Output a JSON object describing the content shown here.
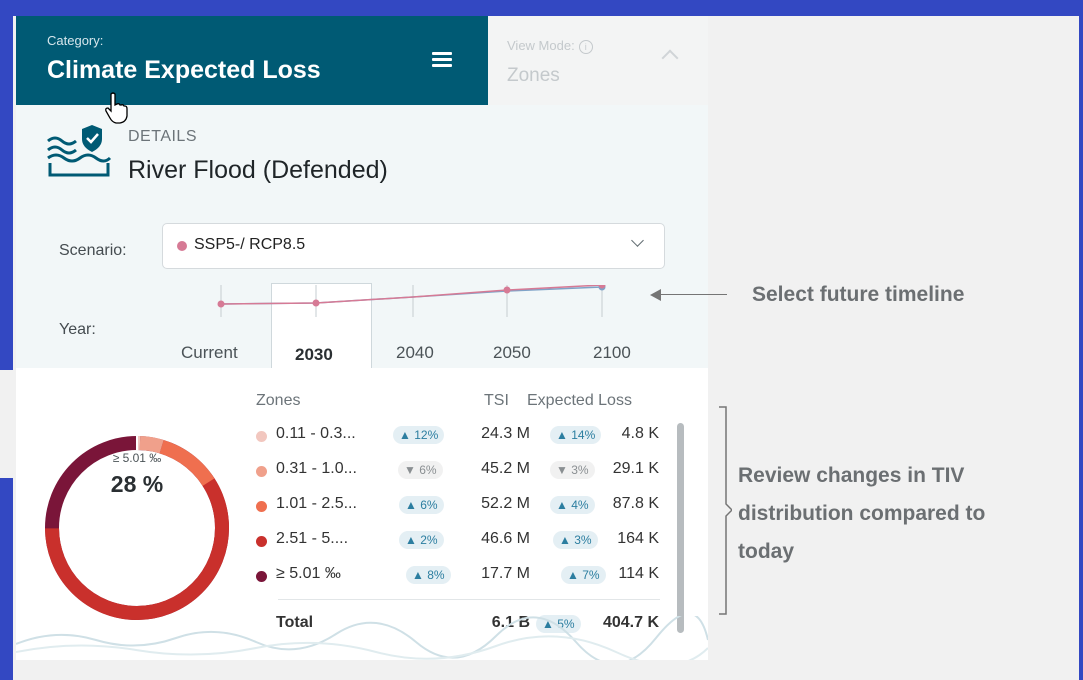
{
  "header": {
    "category_label": "Category:",
    "category_title": "Climate Expected Loss",
    "view_mode_label": "View Mode:",
    "view_mode_value": "Zones"
  },
  "details": {
    "label": "DETAILS",
    "title": "River Flood (Defended)",
    "scenario_label": "Scenario:",
    "scenario_value": "SSP5-/ RCP8.5",
    "scenario_color": "#d67a95",
    "year_label": "Year:",
    "years": [
      "Current",
      "2030",
      "2040",
      "2050",
      "2100"
    ],
    "selected_year": "2030"
  },
  "distribution": {
    "headers": {
      "zones": "Zones",
      "tsi": "TSI",
      "expected_loss": "Expected Loss"
    },
    "donut_label": "≥ 5.01 ‰",
    "donut_value": "28 %",
    "rows": [
      {
        "zone": "0.11 - 0.3...",
        "color": "#f2c7bf",
        "tsi_change": "12%",
        "tsi_dir": "up",
        "tsi": "24.3 M",
        "loss_change": "14%",
        "loss_dir": "up",
        "loss": "4.8 K"
      },
      {
        "zone": "0.31 - 1.0...",
        "color": "#f0a08b",
        "tsi_change": "6%",
        "tsi_dir": "down",
        "tsi": "45.2 M",
        "loss_change": "3%",
        "loss_dir": "down",
        "loss": "29.1 K"
      },
      {
        "zone": "1.01 - 2.5...",
        "color": "#ef6f4f",
        "tsi_change": "6%",
        "tsi_dir": "up",
        "tsi": "52.2 M",
        "loss_change": "4%",
        "loss_dir": "up",
        "loss": "87.8 K"
      },
      {
        "zone": "2.51 - 5....",
        "color": "#c9302c",
        "tsi_change": "2%",
        "tsi_dir": "up",
        "tsi": "46.6 M",
        "loss_change": "3%",
        "loss_dir": "up",
        "loss": "164 K"
      },
      {
        "zone": "≥ 5.01 ‰",
        "color": "#7a1539",
        "tsi_change": "8%",
        "tsi_dir": "up",
        "tsi": "17.7 M",
        "loss_change": "7%",
        "loss_dir": "up",
        "loss": "114 K"
      }
    ],
    "total": {
      "label": "Total",
      "tsi": "6.1 B",
      "loss_change": "5%",
      "loss_dir": "up",
      "loss": "404.7 K"
    }
  },
  "annotations": {
    "timeline": "Select future timeline",
    "review": [
      "Review changes in TIV",
      "distribution compared to",
      "today"
    ]
  }
}
